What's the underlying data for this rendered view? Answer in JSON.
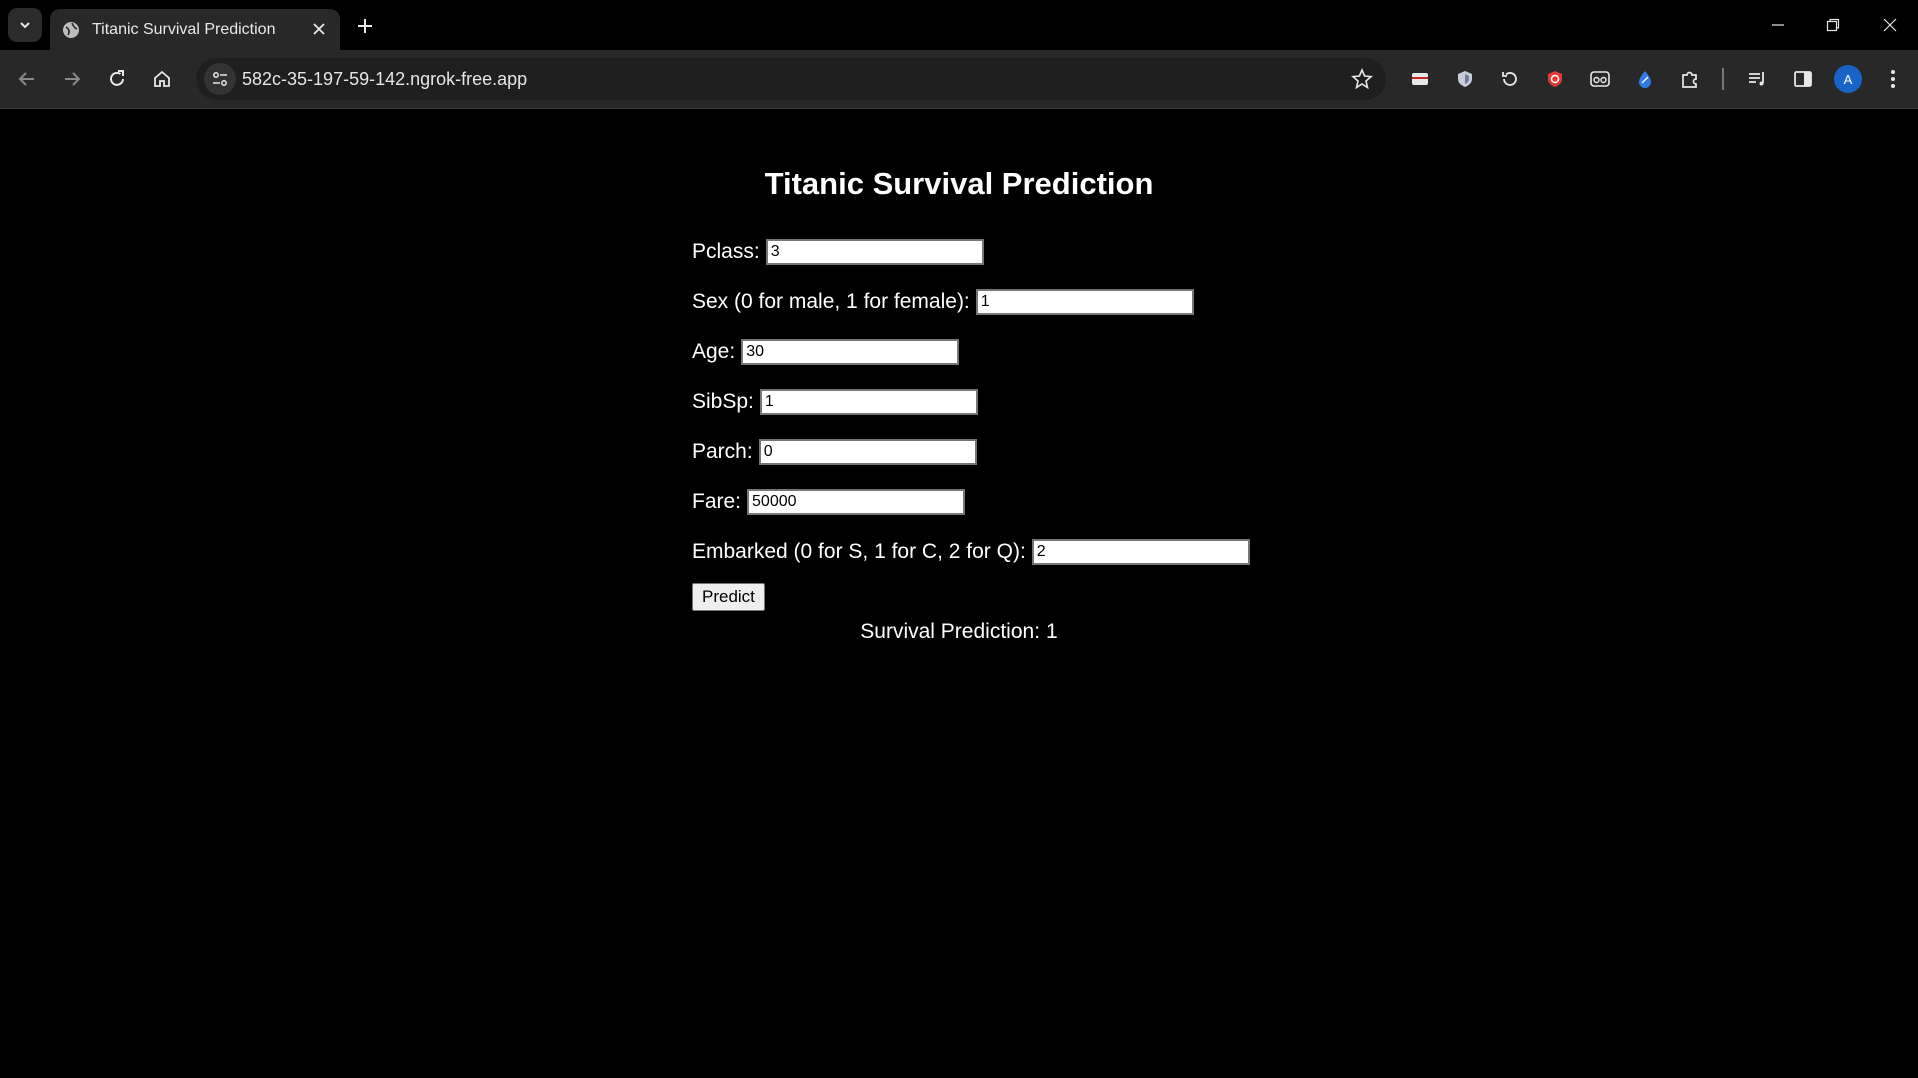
{
  "browser": {
    "tab_title": "Titanic Survival Prediction",
    "url": "582c-35-197-59-142.ngrok-free.app",
    "profile_initial": "A",
    "accent_color": "#1a63c6"
  },
  "page": {
    "title": "Titanic Survival Prediction",
    "fields": [
      {
        "label": "Pclass:",
        "value": "3"
      },
      {
        "label": "Sex (0 for male, 1 for female):",
        "value": "1"
      },
      {
        "label": "Age:",
        "value": "30"
      },
      {
        "label": "SibSp:",
        "value": "1"
      },
      {
        "label": "Parch:",
        "value": "0"
      },
      {
        "label": "Fare:",
        "value": "50000"
      },
      {
        "label": "Embarked (0 for S, 1 for C, 2 for Q):",
        "value": "2"
      }
    ],
    "predict_label": "Predict",
    "result_label": "Survival Prediction:",
    "result_value": "1"
  }
}
